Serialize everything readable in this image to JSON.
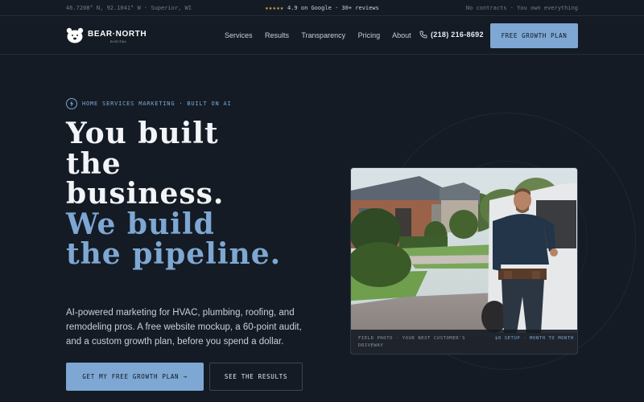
{
  "topbar": {
    "coords": "46.7208° N, 92.1041° W · Superior, WI",
    "stars": "★★★★★",
    "rating": "4.9 on Google · 30+ reviews",
    "guarantee": "No contracts · You own everything"
  },
  "brand": {
    "name": "BEAR·NORTH",
    "sub": "DIGITAL",
    "logo_icon": "bear-head-icon"
  },
  "nav": {
    "links": [
      "Services",
      "Results",
      "Transparency",
      "Pricing",
      "About"
    ],
    "phone": "(218) 216-8692",
    "cta": "FREE GROWTH PLAN"
  },
  "hero": {
    "eyebrow": "HOME SERVICES MARKETING · BUILT ON AI",
    "headline_white": [
      "You built",
      "the",
      "business."
    ],
    "headline_blue": [
      "We build",
      "the pipeline."
    ],
    "subcopy": "AI-powered marketing for HVAC, plumbing, roofing, and remodeling pros. A free website mockup, a 60-point audit, and a custom growth plan, before you spend a dollar.",
    "cta_primary": "GET MY FREE GROWTH PLAN →",
    "cta_secondary": "SEE THE RESULTS"
  },
  "photo": {
    "caption_left": "FIELD PHOTO · YOUR NEXT CUSTOMER'S DRIVEWAY",
    "caption_right": "$0 SETUP · MONTH TO MONTH"
  },
  "colors": {
    "background": "#141b24",
    "accent": "#7ea7d3",
    "star": "#e0b24a"
  }
}
